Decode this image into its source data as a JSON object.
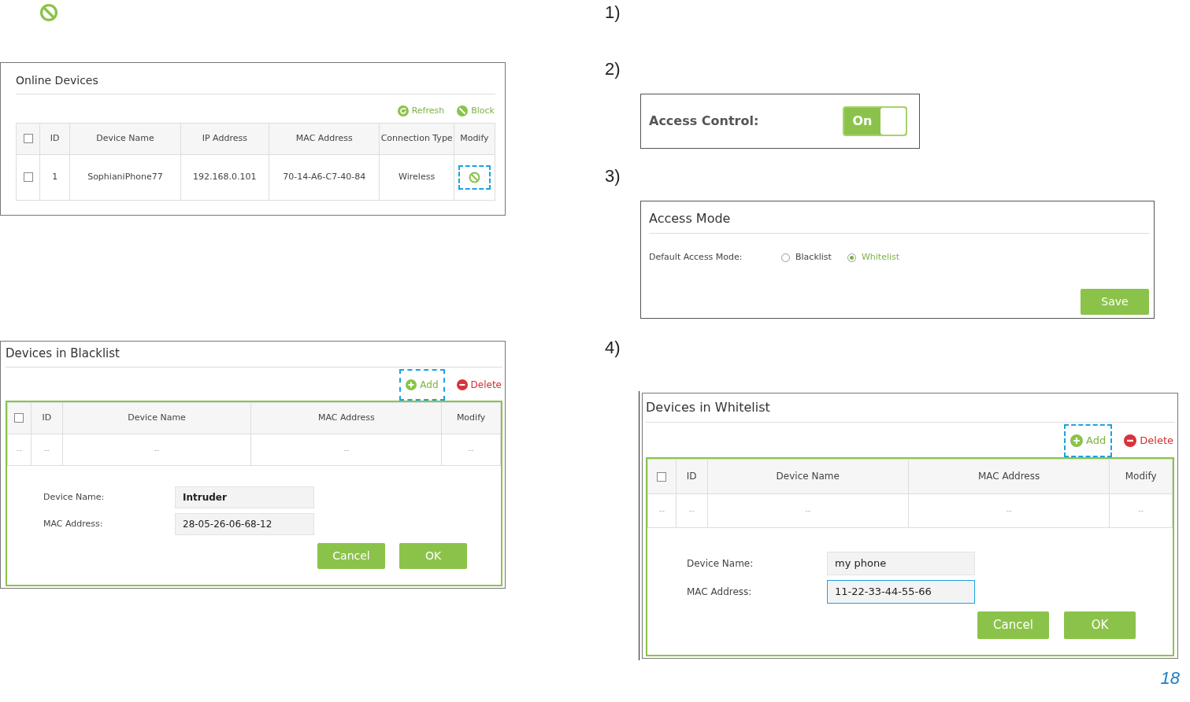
{
  "steps": [
    "1)",
    "2)",
    "3)",
    "4)"
  ],
  "online_devices": {
    "title": "Online Devices",
    "actions": [
      {
        "label": "Refresh",
        "kind": "refresh"
      },
      {
        "label": "Block",
        "kind": "block"
      }
    ],
    "header_checked": false,
    "columns": [
      "ID",
      "Device Name",
      "IP Address",
      "MAC Address",
      "Connection Type",
      "Modify"
    ],
    "rows": [
      {
        "checked": false,
        "cells": [
          "1",
          "SophianiPhone77",
          "192.168.0.101",
          "70-14-A6-C7-40-84",
          "Wireless"
        ],
        "modify_highlighted": true
      }
    ]
  },
  "blacklist": {
    "title": "Devices in Blacklist",
    "actions": [
      {
        "label": "Add",
        "kind": "add",
        "highlighted": true
      },
      {
        "label": "Delete",
        "kind": "delete",
        "highlighted": false
      }
    ],
    "header_checked": false,
    "columns": [
      "ID",
      "Device Name",
      "MAC Address",
      "Modify"
    ],
    "empty_row": [
      "--",
      "--",
      "--",
      "--",
      "--"
    ],
    "fields": [
      {
        "label": "Device Name:",
        "value": "Intruder",
        "focused": false
      },
      {
        "label": "MAC Address:",
        "value": "28-05-26-06-68-12",
        "focused": false
      }
    ],
    "buttons": [
      "Cancel",
      "OK"
    ]
  },
  "access_control": {
    "label": "Access Control:",
    "toggle_label": "On",
    "on": true
  },
  "access_mode": {
    "title": "Access Mode",
    "label": "Default Access Mode:",
    "options": [
      {
        "label": "Blacklist",
        "selected": false
      },
      {
        "label": "Whitelist",
        "selected": true
      }
    ],
    "save": "Save"
  },
  "whitelist": {
    "title": "Devices in Whitelist",
    "actions": [
      {
        "label": "Add",
        "kind": "add",
        "highlighted": true
      },
      {
        "label": "Delete",
        "kind": "delete",
        "highlighted": false
      }
    ],
    "header_checked": false,
    "columns": [
      "ID",
      "Device Name",
      "MAC Address",
      "Modify"
    ],
    "empty_row": [
      "--",
      "--",
      "--",
      "--",
      "--"
    ],
    "fields": [
      {
        "label": "Device Name:",
        "value": "my phone",
        "focused": false
      },
      {
        "label": "MAC Address:",
        "value": "11-22-33-44-55-66",
        "focused": true
      }
    ],
    "buttons": [
      "Cancel",
      "OK"
    ]
  },
  "page_number": "18"
}
